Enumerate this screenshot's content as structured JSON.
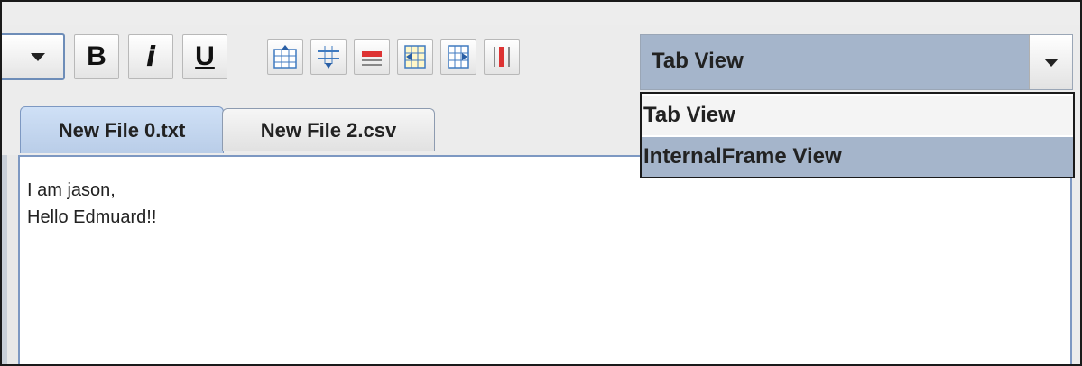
{
  "toolbar": {
    "bold_label": "B",
    "italic_label": "i",
    "underline_label": "U",
    "icons": [
      "insert-row-above-icon",
      "insert-row-below-icon",
      "delete-row-icon",
      "insert-column-left-icon",
      "insert-column-right-icon",
      "delete-column-icon"
    ]
  },
  "view_combo": {
    "selected": "Tab View",
    "options": [
      "Tab View",
      "InternalFrame View"
    ],
    "highlighted": "InternalFrame View"
  },
  "tabs": [
    {
      "label": "New File 0.txt",
      "active": true
    },
    {
      "label": "New File 2.csv",
      "active": false
    }
  ],
  "editor": {
    "lines": [
      "I am jason,",
      "Hello Edmuard!!"
    ]
  },
  "colors": {
    "combo_bg": "#a5b5cb",
    "tab_active": "#b9cde8",
    "editor_border": "#7d98c2"
  }
}
